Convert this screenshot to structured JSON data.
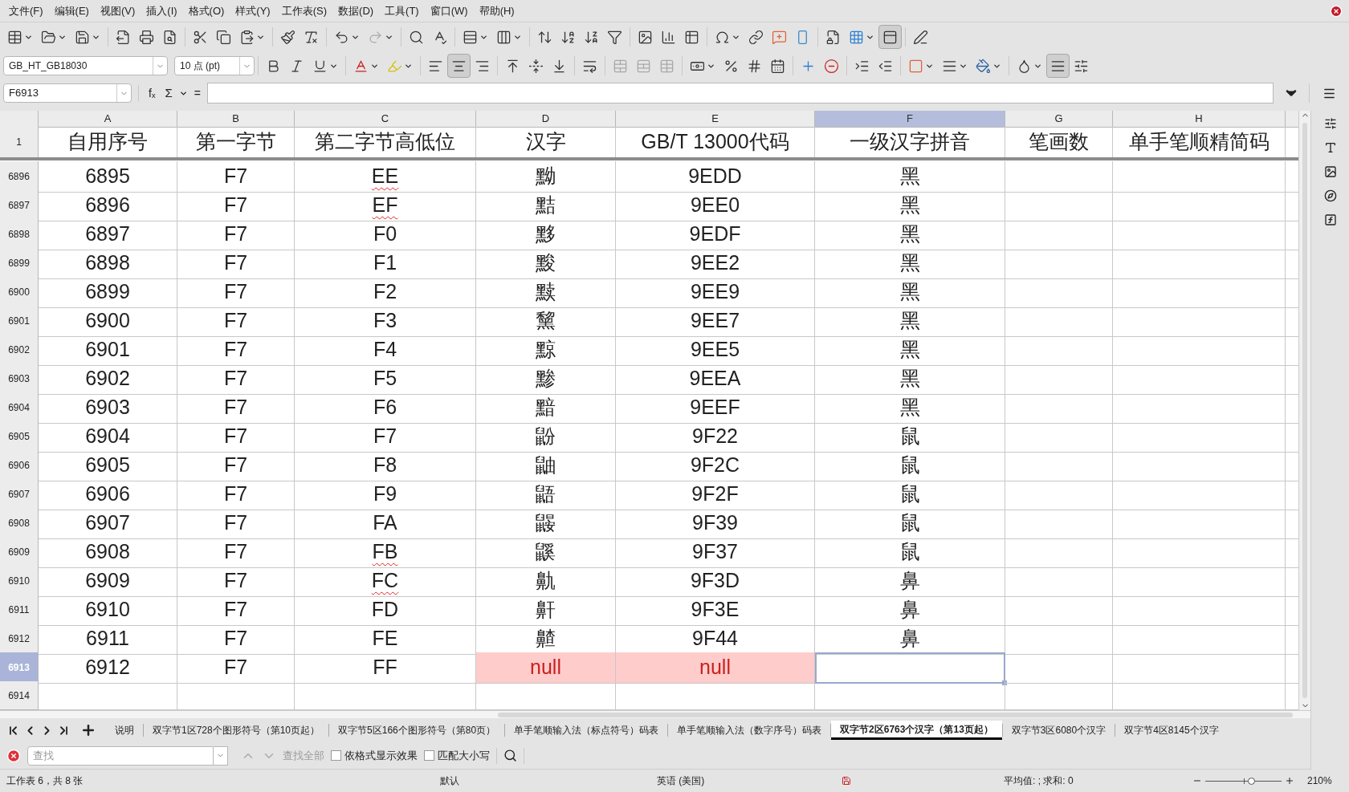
{
  "menu": [
    "文件(F)",
    "编辑(E)",
    "视图(V)",
    "插入(I)",
    "格式(O)",
    "样式(Y)",
    "工作表(S)",
    "数据(D)",
    "工具(T)",
    "窗口(W)",
    "帮助(H)"
  ],
  "standard_toolbar": {
    "freeze_rows": {
      "selected": true
    }
  },
  "format_toolbar": {
    "font_name": "GB_HT_GB18030",
    "font_size": "10 点 (pt)",
    "align_left": {
      "selected": false
    },
    "align_center": {
      "selected": true
    },
    "align_right": {
      "selected": false
    },
    "wrap_text": {
      "selected": true
    }
  },
  "formula_bar": {
    "name_box": "F6913",
    "function_wizard": "fₓ",
    "sum": "Σ",
    "equals": "="
  },
  "columns": [
    {
      "label": "A",
      "selected": false
    },
    {
      "label": "B",
      "selected": false
    },
    {
      "label": "C",
      "selected": false
    },
    {
      "label": "D",
      "selected": false
    },
    {
      "label": "E",
      "selected": false
    },
    {
      "label": "F",
      "selected": true
    },
    {
      "label": "G",
      "selected": false
    },
    {
      "label": "H",
      "selected": false
    }
  ],
  "header_row": {
    "number": "1",
    "cells": [
      "自用序号",
      "第一字节",
      "第二字节高低位",
      "汉字",
      "GB/T 13000代码",
      "一级汉字拼音",
      "笔画数",
      "单手笔顺精简码"
    ]
  },
  "rows": [
    {
      "number": "6896",
      "selected": false,
      "spell_flagged": true,
      "cells": [
        "6895",
        "F7",
        "EE",
        "黝",
        "9EDD",
        "黑",
        "",
        ""
      ]
    },
    {
      "number": "6897",
      "selected": false,
      "spell_flagged": true,
      "cells": [
        "6896",
        "F7",
        "EF",
        "黠",
        "9EE0",
        "黑",
        "",
        ""
      ]
    },
    {
      "number": "6898",
      "selected": false,
      "spell_flagged": false,
      "cells": [
        "6897",
        "F7",
        "F0",
        "黟",
        "9EDF",
        "黑",
        "",
        ""
      ]
    },
    {
      "number": "6899",
      "selected": false,
      "spell_flagged": false,
      "cells": [
        "6898",
        "F7",
        "F1",
        "黢",
        "9EE2",
        "黑",
        "",
        ""
      ]
    },
    {
      "number": "6900",
      "selected": false,
      "spell_flagged": false,
      "cells": [
        "6899",
        "F7",
        "F2",
        "黩",
        "9EE9",
        "黑",
        "",
        ""
      ]
    },
    {
      "number": "6901",
      "selected": false,
      "spell_flagged": false,
      "cells": [
        "6900",
        "F7",
        "F3",
        "黧",
        "9EE7",
        "黑",
        "",
        ""
      ]
    },
    {
      "number": "6902",
      "selected": false,
      "spell_flagged": false,
      "cells": [
        "6901",
        "F7",
        "F4",
        "黥",
        "9EE5",
        "黑",
        "",
        ""
      ]
    },
    {
      "number": "6903",
      "selected": false,
      "spell_flagged": false,
      "cells": [
        "6902",
        "F7",
        "F5",
        "黪",
        "9EEA",
        "黑",
        "",
        ""
      ]
    },
    {
      "number": "6904",
      "selected": false,
      "spell_flagged": false,
      "cells": [
        "6903",
        "F7",
        "F6",
        "黯",
        "9EEF",
        "黑",
        "",
        ""
      ]
    },
    {
      "number": "6905",
      "selected": false,
      "spell_flagged": false,
      "cells": [
        "6904",
        "F7",
        "F7",
        "鼢",
        "9F22",
        "鼠",
        "",
        ""
      ]
    },
    {
      "number": "6906",
      "selected": false,
      "spell_flagged": false,
      "cells": [
        "6905",
        "F7",
        "F8",
        "鼬",
        "9F2C",
        "鼠",
        "",
        ""
      ]
    },
    {
      "number": "6907",
      "selected": false,
      "spell_flagged": false,
      "cells": [
        "6906",
        "F7",
        "F9",
        "鼯",
        "9F2F",
        "鼠",
        "",
        ""
      ]
    },
    {
      "number": "6908",
      "selected": false,
      "spell_flagged": false,
      "cells": [
        "6907",
        "F7",
        "FA",
        "鼹",
        "9F39",
        "鼠",
        "",
        ""
      ]
    },
    {
      "number": "6909",
      "selected": false,
      "spell_flagged": true,
      "cells": [
        "6908",
        "F7",
        "FB",
        "鼷",
        "9F37",
        "鼠",
        "",
        ""
      ]
    },
    {
      "number": "6910",
      "selected": false,
      "spell_flagged": true,
      "cells": [
        "6909",
        "F7",
        "FC",
        "鼽",
        "9F3D",
        "鼻",
        "",
        ""
      ]
    },
    {
      "number": "6911",
      "selected": false,
      "spell_flagged": false,
      "cells": [
        "6910",
        "F7",
        "FD",
        "鼾",
        "9F3E",
        "鼻",
        "",
        ""
      ]
    },
    {
      "number": "6912",
      "selected": false,
      "spell_flagged": false,
      "cells": [
        "6911",
        "F7",
        "FE",
        "齄",
        "9F44",
        "鼻",
        "",
        ""
      ]
    },
    {
      "number": "6913",
      "selected": true,
      "spell_flagged": false,
      "flags": [
        false,
        false,
        false,
        true,
        true,
        false,
        false,
        false
      ],
      "cells": [
        "6912",
        "F7",
        "FF",
        "null",
        "null",
        "",
        "",
        ""
      ]
    },
    {
      "number": "6914",
      "selected": false,
      "spell_flagged": false,
      "cells": [
        "",
        "",
        "",
        "",
        "",
        "",
        "",
        ""
      ]
    }
  ],
  "sheet_tabs": [
    {
      "label": "说明",
      "selected": false
    },
    {
      "label": "双字节1区728个图形符号（第10页起）",
      "selected": false
    },
    {
      "label": "双字节5区166个图形符号（第80页）",
      "selected": false
    },
    {
      "label": "单手笔顺输入法（标点符号）码表",
      "selected": false
    },
    {
      "label": "单手笔顺输入法（数字序号）码表",
      "selected": false
    },
    {
      "label": "双字节2区6763个汉字（第13页起）",
      "selected": true
    },
    {
      "label": "双字节3区6080个汉字",
      "selected": false
    },
    {
      "label": "双字节4区8145个汉字",
      "selected": false
    }
  ],
  "find_bar": {
    "placeholder": "查找",
    "find_all": {
      "label": "查找全部",
      "disabled": true
    },
    "options": [
      {
        "label": "依格式显示效果",
        "checked": false
      },
      {
        "label": "匹配大小写",
        "checked": false
      }
    ]
  },
  "status_bar": {
    "sheet": "工作表 6，共 8 张",
    "page_style": "默认",
    "language": "英语 (美国)",
    "summary": "平均值: ; 求和: 0",
    "zoom": {
      "level": 0.6,
      "reading": "210%"
    }
  }
}
